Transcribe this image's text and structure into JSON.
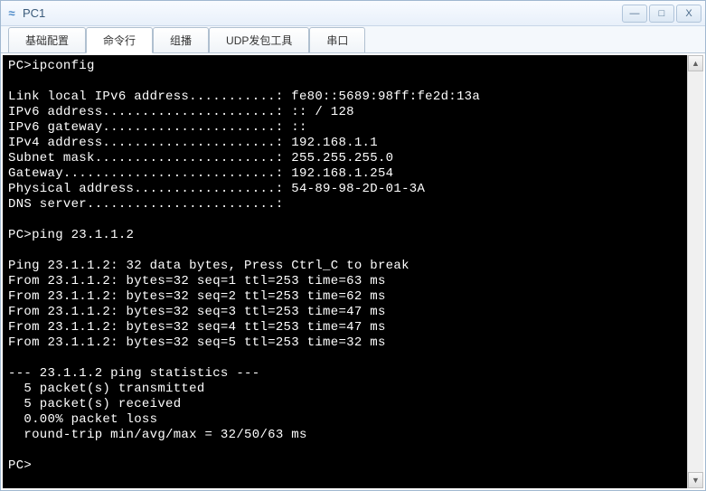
{
  "window": {
    "title": "PC1",
    "icon_glyph": "≈"
  },
  "controls": {
    "minimize": "—",
    "maximize": "□",
    "close": "X"
  },
  "tabs": [
    {
      "label": "基础配置",
      "active": false
    },
    {
      "label": "命令行",
      "active": true
    },
    {
      "label": "组播",
      "active": false
    },
    {
      "label": "UDP发包工具",
      "active": false
    },
    {
      "label": "串口",
      "active": false
    }
  ],
  "terminal": {
    "lines": [
      "PC>ipconfig",
      "",
      "Link local IPv6 address...........: fe80::5689:98ff:fe2d:13a",
      "IPv6 address......................: :: / 128",
      "IPv6 gateway......................: ::",
      "IPv4 address......................: 192.168.1.1",
      "Subnet mask.......................: 255.255.255.0",
      "Gateway...........................: 192.168.1.254",
      "Physical address..................: 54-89-98-2D-01-3A",
      "DNS server........................:",
      "",
      "PC>ping 23.1.1.2",
      "",
      "Ping 23.1.1.2: 32 data bytes, Press Ctrl_C to break",
      "From 23.1.1.2: bytes=32 seq=1 ttl=253 time=63 ms",
      "From 23.1.1.2: bytes=32 seq=2 ttl=253 time=62 ms",
      "From 23.1.1.2: bytes=32 seq=3 ttl=253 time=47 ms",
      "From 23.1.1.2: bytes=32 seq=4 ttl=253 time=47 ms",
      "From 23.1.1.2: bytes=32 seq=5 ttl=253 time=32 ms",
      "",
      "--- 23.1.1.2 ping statistics ---",
      "  5 packet(s) transmitted",
      "  5 packet(s) received",
      "  0.00% packet loss",
      "  round-trip min/avg/max = 32/50/63 ms",
      "",
      "PC>"
    ]
  },
  "scroll": {
    "up": "▲",
    "down": "▼"
  }
}
